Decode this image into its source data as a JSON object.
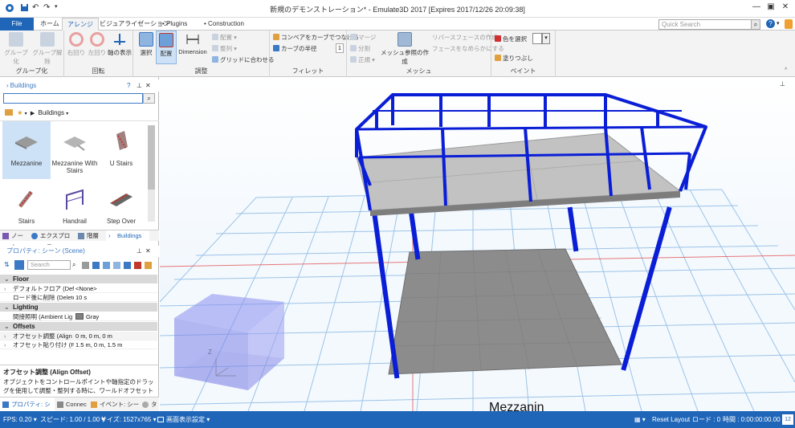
{
  "window": {
    "title": "新規のデモンストレーション* - Emulate3D 2017 [Expires 2017/12/26 20:09:38]"
  },
  "ribbon_tabs": [
    "File",
    "ホーム",
    "アレンジ",
    "ビジュアライゼーション",
    "Plugins",
    "Construction"
  ],
  "search": {
    "placeholder": "Quick Search"
  },
  "ribbon": {
    "group_grouping": {
      "label": "グループ化",
      "buttons": [
        "グループ化",
        "グループ解除"
      ]
    },
    "group_rotate": {
      "label": "回転",
      "buttons": [
        "右回り",
        "左回り",
        "軸の表示"
      ]
    },
    "group_adjust": {
      "label": "調整",
      "buttons": [
        "選択",
        "配置",
        "Dimension"
      ],
      "small": [
        "配置",
        "整列",
        "グリッドに合わせる"
      ]
    },
    "group_fillet": {
      "label": "フィレット",
      "small": [
        "コンベアをカーブでつなげる",
        "カーブの半径"
      ],
      "radius_value": "1"
    },
    "group_mesh": {
      "label": "メッシュ",
      "small": [
        "マージ",
        "分割",
        "正規",
        "リバースフェースの作成",
        "フェースをなめらかにする"
      ],
      "button": "メッシュ参照の作成"
    },
    "group_paint": {
      "label": "ペイント",
      "small": [
        "色を選択",
        "塗りつぶし"
      ]
    }
  },
  "library": {
    "title": "Buildings",
    "breadcrumb": "Buildings",
    "items": [
      {
        "label": "Mezzanine",
        "selected": true
      },
      {
        "label": "Mezzanine With Stairs",
        "selected": false
      },
      {
        "label": "U Stairs",
        "selected": false
      },
      {
        "label": "Stairs",
        "selected": false
      },
      {
        "label": "Handrail",
        "selected": false
      },
      {
        "label": "Step Over",
        "selected": false
      }
    ],
    "tabs": [
      "ノート",
      "エクスプローラ",
      "階層",
      "Buildings"
    ]
  },
  "properties": {
    "title": "プロパティ: シーン (Scene)",
    "search_placeholder": "Search",
    "categories": [
      {
        "name": "Floor",
        "rows": [
          {
            "name": "デフォルトフロア (Default",
            "value": "<None>"
          },
          {
            "name": "ロード後に削除 (Delete",
            "value": "10 s"
          }
        ]
      },
      {
        "name": "Lighting",
        "rows": [
          {
            "name": "間接照明 (Ambient Lig",
            "value": "Gray"
          }
        ]
      },
      {
        "name": "Offsets",
        "rows": [
          {
            "name": "オフセット調整 (Align O",
            "value": "0 m, 0 m, 0 m"
          },
          {
            "name": "オフセット貼り付け (Paste",
            "value": "1.5 m, 0 m, 1.5 m"
          }
        ]
      }
    ],
    "description_title": "オフセット調整 (Align Offset)",
    "description_text": "オブジェクトをコントロールポイントや軸指定のドラッグを使用して調整・整列する時に、ワールドオフセットとしてこれを追加...",
    "bottom_tabs": [
      "プロパティ: シーン",
      "Connec",
      "イベント: シーン (",
      "タ"
    ]
  },
  "viewport": {
    "floor_label": "Mezzanin",
    "axis_label": "Z"
  },
  "status": {
    "fps": "FPS: 0.20",
    "speed": "スピード: 1.00 / 1.00",
    "size": "サイズ: 1527x765",
    "display": "画面表示設定",
    "reset": "Reset Layout",
    "load": "ロード : 0",
    "time": "時間 : 0:00:00:00.00",
    "badge": "12"
  },
  "colors": {
    "accent": "#1f66b8",
    "frame": "#0a1ed6",
    "deck": "#bdbdbd",
    "floor_grid": "#9cc3e6"
  }
}
